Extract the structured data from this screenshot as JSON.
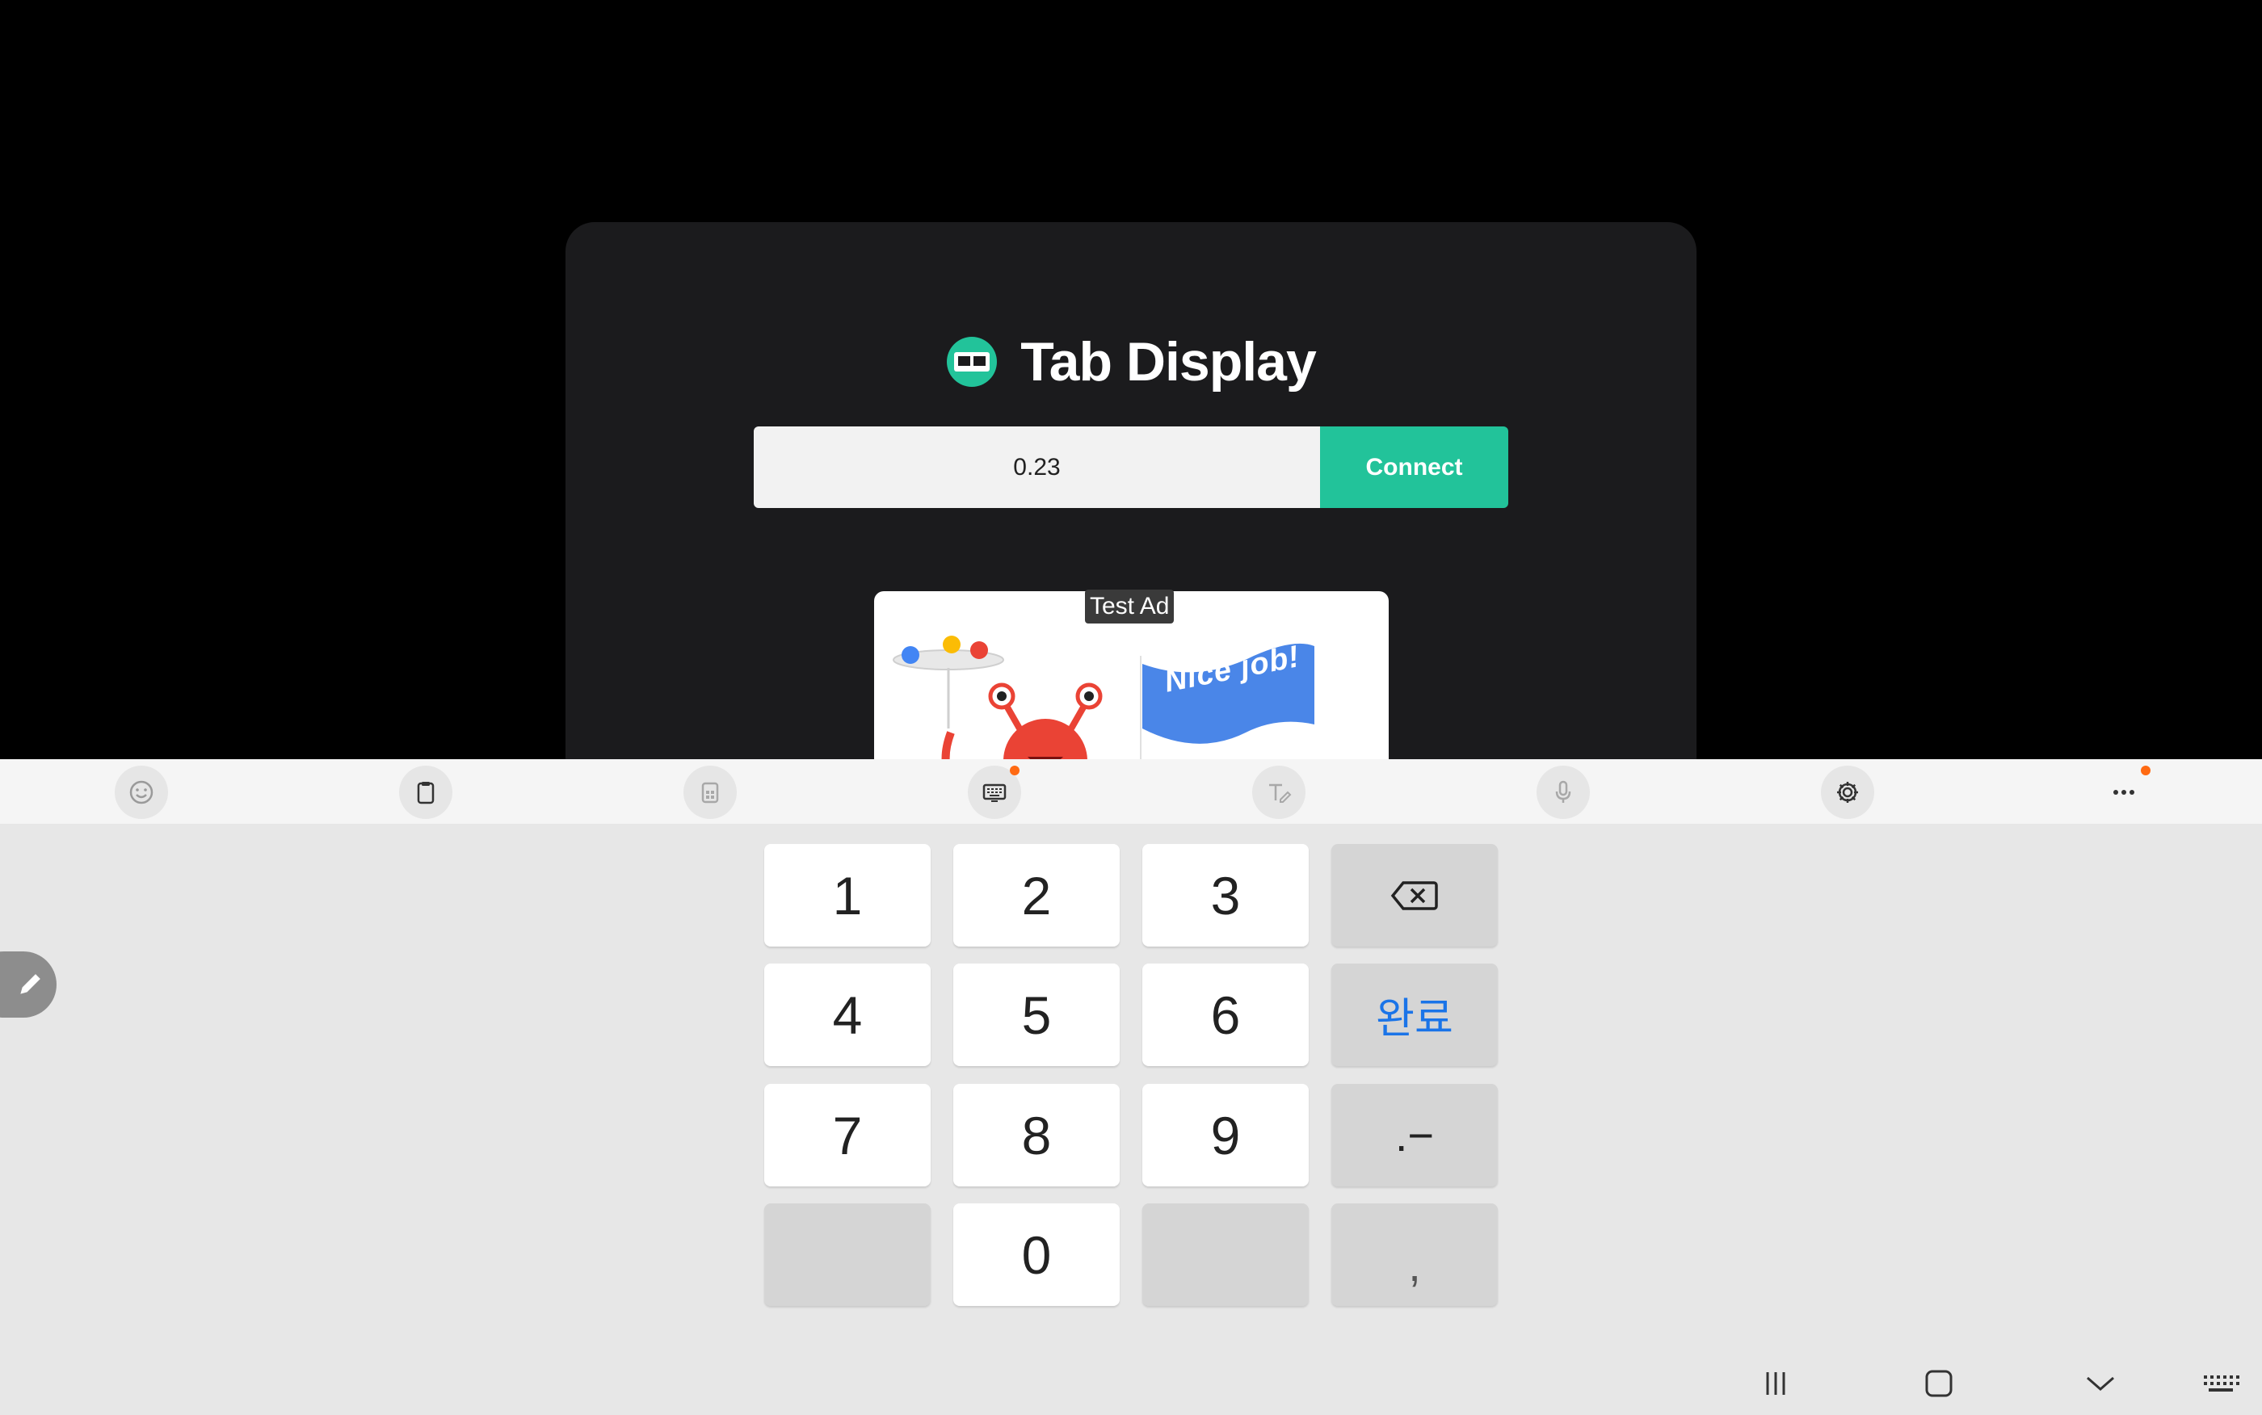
{
  "app": {
    "title": "Tab Display",
    "ip_value": "0.23",
    "connect_label": "Connect",
    "ad_badge": "Test Ad",
    "ad_banner_text": "Nice job!",
    "accent_color": "#22c39a"
  },
  "keyboard": {
    "toolbar_icons": [
      "emoji-icon",
      "clipboard-icon",
      "keyboard-mode-icon",
      "keyboard-icon",
      "handwriting-icon",
      "microphone-icon",
      "settings-icon",
      "more-icon"
    ],
    "keys": {
      "k1": "1",
      "k2": "2",
      "k3": "3",
      "k4": "4",
      "k5": "5",
      "k6": "6",
      "k7": "7",
      "k8": "8",
      "k9": "9",
      "k0": "0",
      "done": "완료",
      "dot_minus": ".−",
      "comma": ","
    }
  },
  "navbar": {
    "icons": [
      "recent-apps-icon",
      "home-icon",
      "back-icon",
      "keyboard-switch-icon"
    ]
  }
}
